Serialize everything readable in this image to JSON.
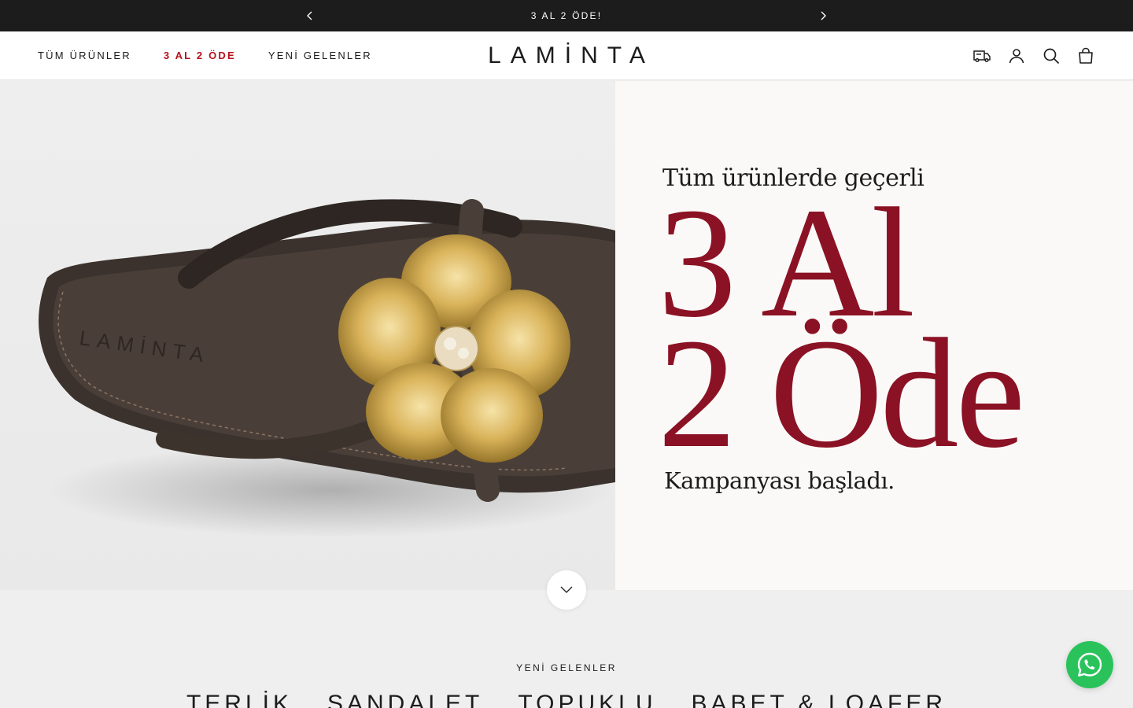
{
  "announcement": {
    "text": "3 AL 2 ÖDE!",
    "prev_icon": "chevron-left-icon",
    "next_icon": "chevron-right-icon"
  },
  "header": {
    "logo": "LAMİNTA",
    "nav": [
      {
        "label": "TÜM ÜRÜNLER"
      },
      {
        "label": "3 AL 2 ÖDE",
        "color": "#b5121b"
      },
      {
        "label": "YENİ GELENLER"
      }
    ],
    "icons": [
      "delivery-truck-icon",
      "account-icon",
      "search-icon",
      "shopping-bag-icon"
    ]
  },
  "hero": {
    "promo_subtitle": "Tüm ürünlerde geçerli",
    "promo_line1": "3 Al",
    "promo_line2": "2 Öde",
    "promo_footer": "Kampanyası başladı.",
    "promo_color": "#8b1224",
    "image_brand_emboss": "LAMİNTA",
    "scroll_icon": "chevron-down-icon"
  },
  "new_arrivals": {
    "label": "YENİ GELENLER",
    "categories": [
      "TERLİK",
      "SANDALET",
      "TOPUKLU",
      "BABET & LOAFER"
    ]
  },
  "whatsapp": {
    "icon": "whatsapp-icon",
    "color": "#2ac35b"
  }
}
